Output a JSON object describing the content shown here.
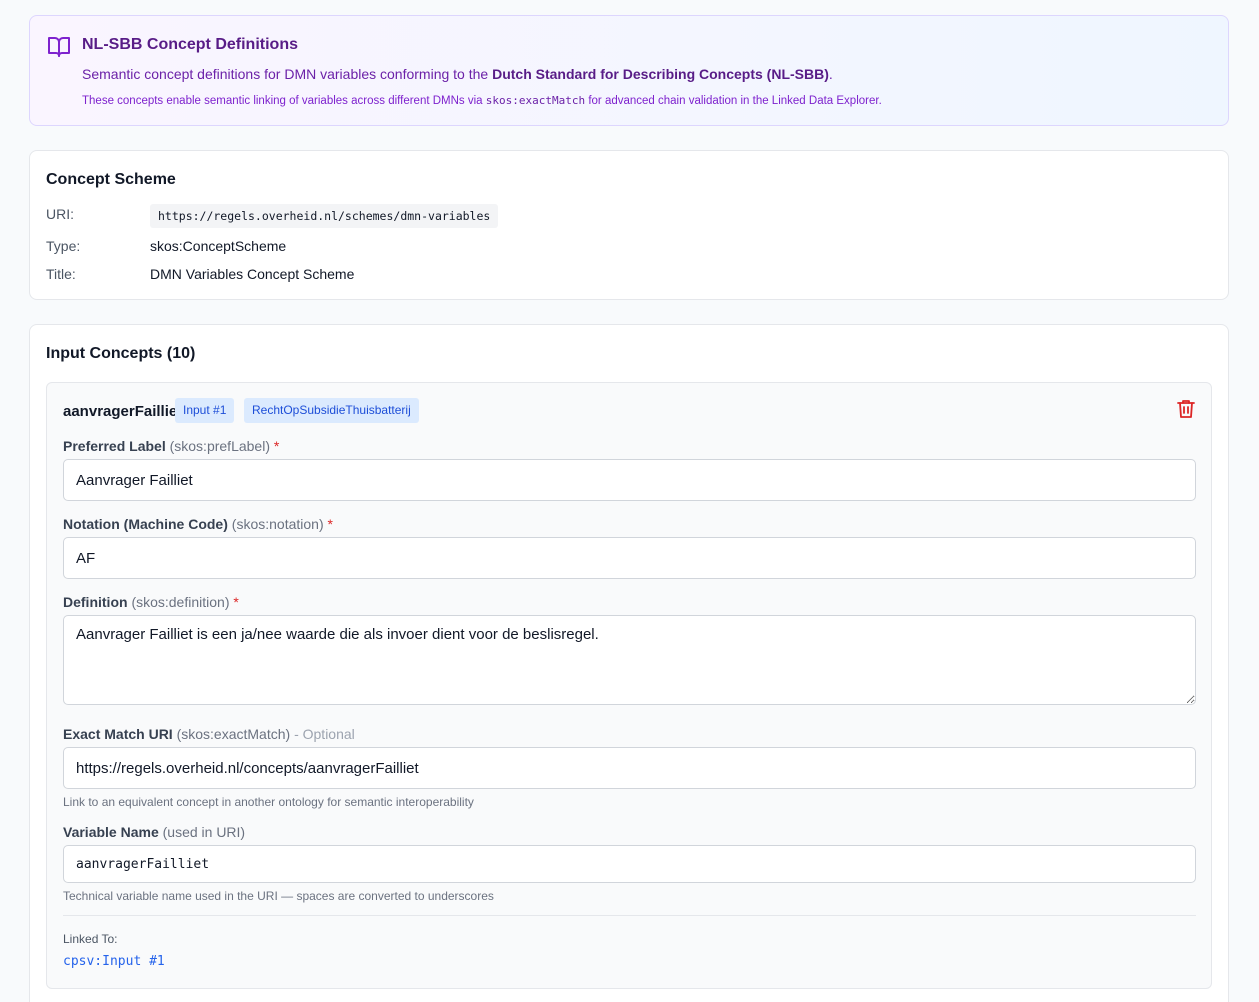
{
  "banner": {
    "title": "NL-SBB Concept Definitions",
    "desc_prefix": "Semantic concept definitions for DMN variables conforming to the",
    "desc_bold": "Dutch Standard for Describing Concepts (NL-SBB)",
    "desc_suffix": ".",
    "note_prefix": "These concepts enable semantic linking of variables across different DMNs via",
    "note_code": "skos:exactMatch",
    "note_suffix": "for advanced chain validation in the Linked Data Explorer.",
    "icon": "book-open-icon"
  },
  "scheme": {
    "heading": "Concept Scheme",
    "uri_label": "URI:",
    "uri_value": "https://regels.overheid.nl/schemes/dmn-variables",
    "type_label": "Type:",
    "type_value": "skos:ConceptScheme",
    "title_label": "Title:",
    "title_value": "DMN Variables Concept Scheme"
  },
  "inputs": {
    "heading": "Input Concepts (10)",
    "concept": {
      "name": "aanvragerFailliet",
      "tag_input": "Input #1",
      "tag_model": "RechtOpSubsidieThuisbatterij",
      "pref_label": {
        "label": "Preferred Label",
        "sub": "(skos:prefLabel)",
        "req": "*",
        "value": "Aanvrager Failliet"
      },
      "notation": {
        "label": "Notation (Machine Code)",
        "sub": "(skos:notation)",
        "req": "*",
        "value": "AF"
      },
      "definition": {
        "label": "Definition",
        "sub": "(skos:definition)",
        "req": "*",
        "value": "Aanvrager Failliet is een ja/nee waarde die als invoer dient voor de beslisregel."
      },
      "exact_match": {
        "label": "Exact Match URI",
        "sub": "(skos:exactMatch)",
        "opt": "- Optional",
        "value": "https://regels.overheid.nl/concepts/aanvragerFailliet",
        "help": "Link to an equivalent concept in another ontology for semantic interoperability"
      },
      "variable_name": {
        "label": "Variable Name",
        "sub": "(used in URI)",
        "value": "aanvragerFailliet",
        "help": "Technical variable name used in the URI — spaces are converted to underscores"
      },
      "linked_label": "Linked To:",
      "linked_value": "cpsv:Input #1"
    }
  },
  "colors": {
    "accent_purple": "#581c87",
    "link_blue": "#2563eb",
    "danger_red": "#dc2626",
    "tag_bg": "#dbeafe"
  }
}
